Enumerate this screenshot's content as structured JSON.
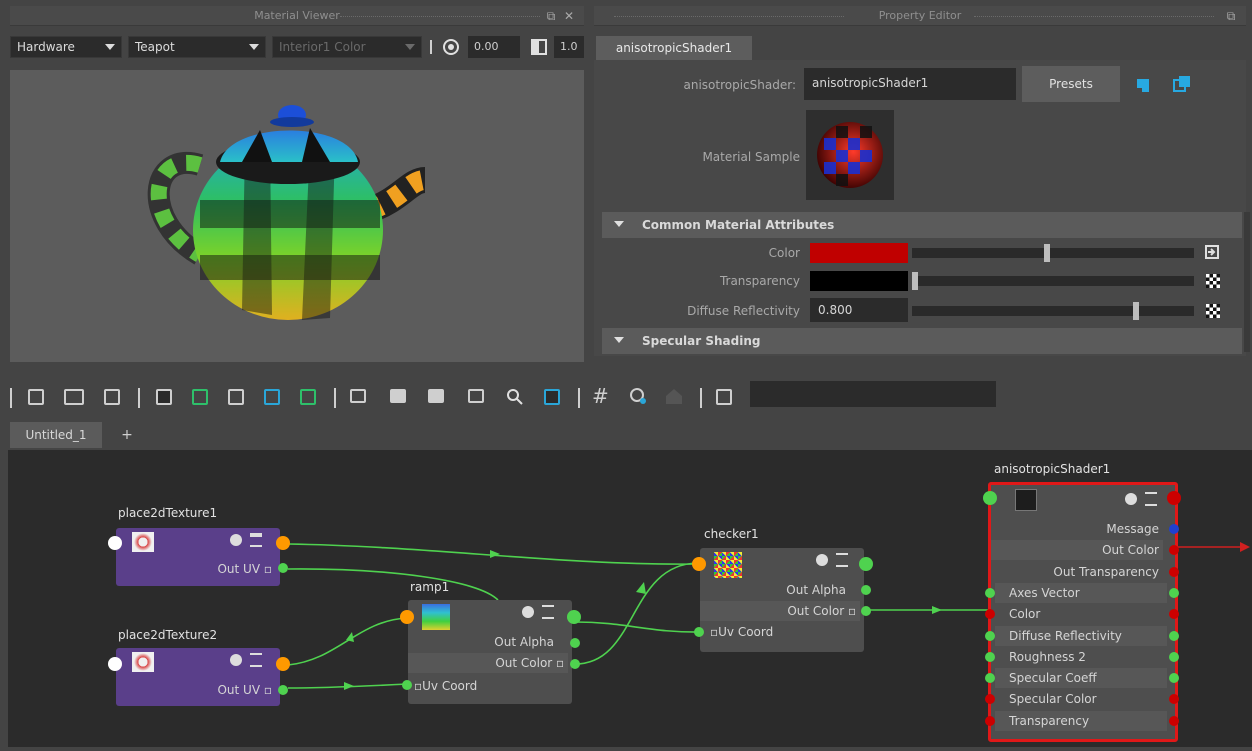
{
  "material_viewer": {
    "title": "Material Viewer",
    "renderer": "Hardware",
    "geometry": "Teapot",
    "environment": "Interior1 Color",
    "exposure": "0.00",
    "gamma": "1.0"
  },
  "property_editor": {
    "title": "Property Editor",
    "tab": "anisotropicShader1",
    "type_label": "anisotropicShader:",
    "name_value": "anisotropicShader1",
    "presets_label": "Presets",
    "material_sample_label": "Material Sample",
    "sections": {
      "common": "Common Material Attributes",
      "specular": "Specular Shading"
    },
    "attributes": {
      "color_label": "Color",
      "color_value": "#c00000",
      "color_slider": 0.48,
      "transparency_label": "Transparency",
      "transparency_value": "#000000",
      "transparency_slider": 0.0,
      "diffuse_label": "Diffuse Reflectivity",
      "diffuse_value": "0.800",
      "diffuse_slider": 0.8
    }
  },
  "node_editor": {
    "tab": "Untitled_1",
    "add_tab": "+",
    "nodes": {
      "place2d1": {
        "title": "place2dTexture1",
        "out_uv": "Out UV"
      },
      "place2d2": {
        "title": "place2dTexture2",
        "out_uv": "Out UV"
      },
      "ramp": {
        "title": "ramp1",
        "out_alpha": "Out Alpha",
        "out_color": "Out Color",
        "uv_coord": "Uv Coord"
      },
      "checker": {
        "title": "checker1",
        "out_alpha": "Out Alpha",
        "out_color": "Out Color",
        "uv_coord": "Uv Coord"
      },
      "shader": {
        "title": "anisotropicShader1",
        "ports": [
          "Message",
          "Out Color",
          "Out Transparency",
          "Axes Vector",
          "Color",
          "Diffuse Reflectivity",
          "Roughness 2",
          "Specular Coeff",
          "Specular Color",
          "Transparency"
        ]
      }
    }
  },
  "colors": {
    "accent_connection": "#4fd24f",
    "port_orange": "#ff9900",
    "port_red": "#cc0000",
    "place2d_node": "#5a3f8a",
    "selected_border": "#e01818"
  }
}
